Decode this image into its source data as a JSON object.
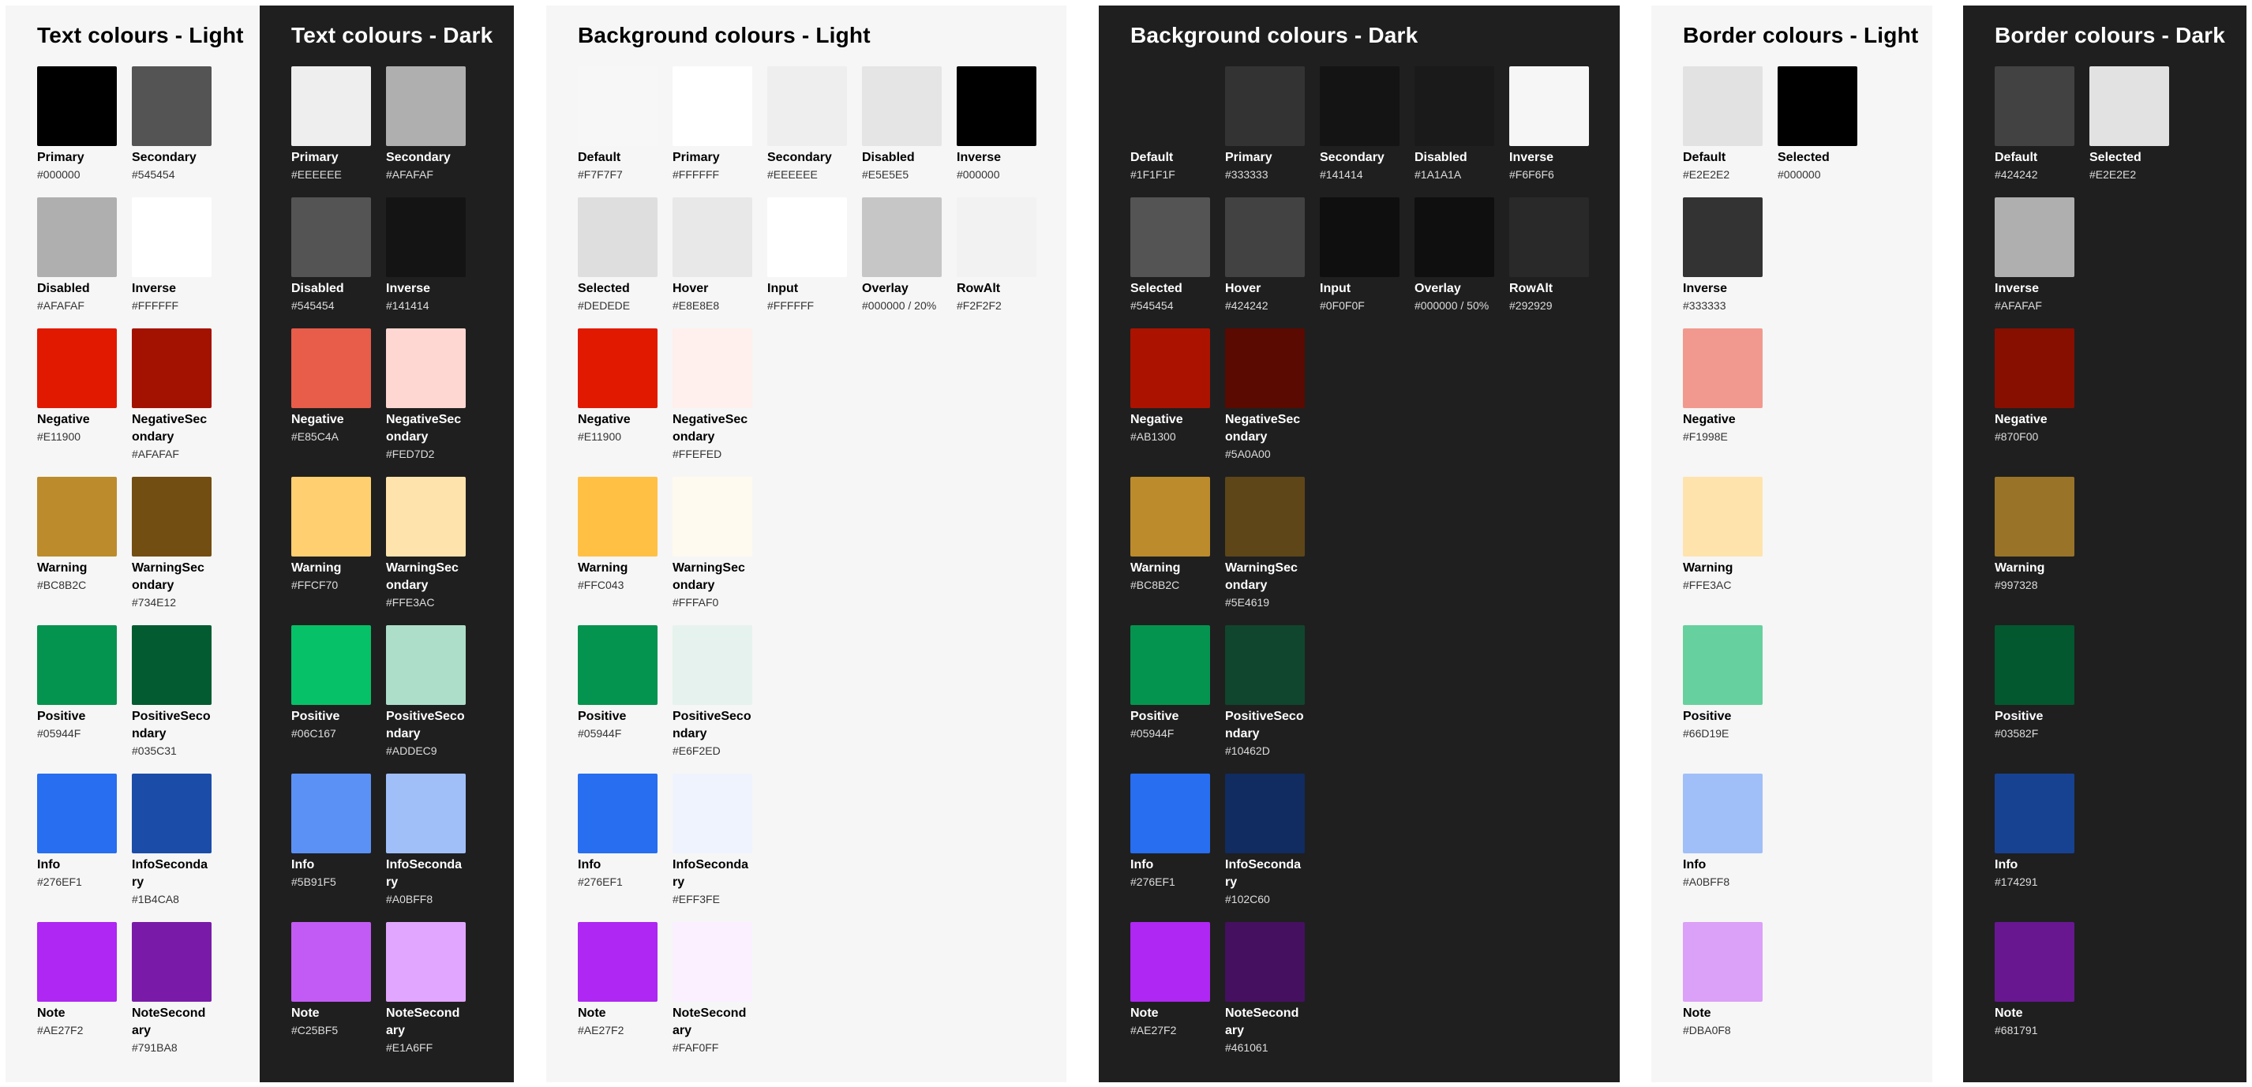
{
  "panels": [
    {
      "id": "text-light",
      "title": "Text colours - Light",
      "theme": "light",
      "columns": 2,
      "rows": [
        [
          {
            "name": "Primary",
            "hex": "#000000",
            "color": "#000000"
          },
          {
            "name": "Secondary",
            "hex": "#545454",
            "color": "#545454"
          }
        ],
        [
          {
            "name": "Disabled",
            "hex": "#AFAFAF",
            "color": "#AFAFAF"
          },
          {
            "name": "Inverse",
            "hex": "#FFFFFF",
            "color": "#FFFFFF"
          }
        ],
        [
          {
            "name": "Negative",
            "hex": "#E11900",
            "color": "#E11900"
          },
          {
            "name": "NegativeSecondary",
            "hex": "#AFAFAF",
            "color": "#A31201"
          }
        ],
        [
          {
            "name": "Warning",
            "hex": "#BC8B2C",
            "color": "#BC8B2C"
          },
          {
            "name": "WarningSecondary",
            "hex": "#734E12",
            "color": "#734E12"
          }
        ],
        [
          {
            "name": "Positive",
            "hex": "#05944F",
            "color": "#05944F"
          },
          {
            "name": "PositiveSecondary",
            "hex": "#035C31",
            "color": "#035C31"
          }
        ],
        [
          {
            "name": "Info",
            "hex": "#276EF1",
            "color": "#276EF1"
          },
          {
            "name": "InfoSecondary",
            "hex": "#1B4CA8",
            "color": "#1B4CA8"
          }
        ],
        [
          {
            "name": "Note",
            "hex": "#AE27F2",
            "color": "#AE27F2"
          },
          {
            "name": "NoteSecondary",
            "hex": "#791BA8",
            "color": "#791BA8"
          }
        ]
      ]
    },
    {
      "id": "text-dark",
      "title": "Text colours - Dark",
      "theme": "dark",
      "columns": 2,
      "rows": [
        [
          {
            "name": "Primary",
            "hex": "#EEEEEE",
            "color": "#EEEEEE"
          },
          {
            "name": "Secondary",
            "hex": "#AFAFAF",
            "color": "#AFAFAF"
          }
        ],
        [
          {
            "name": "Disabled",
            "hex": "#545454",
            "color": "#545454"
          },
          {
            "name": "Inverse",
            "hex": "#141414",
            "color": "#141414"
          }
        ],
        [
          {
            "name": "Negative",
            "hex": "#E85C4A",
            "color": "#E85C4A"
          },
          {
            "name": "NegativeSecondary",
            "hex": "#FED7D2",
            "color": "#FED7D2"
          }
        ],
        [
          {
            "name": "Warning",
            "hex": "#FFCF70",
            "color": "#FFCF70"
          },
          {
            "name": "WarningSecondary",
            "hex": "#FFE3AC",
            "color": "#FFE3AC"
          }
        ],
        [
          {
            "name": "Positive",
            "hex": "#06C167",
            "color": "#06C167"
          },
          {
            "name": "PositiveSecondary",
            "hex": "#ADDEC9",
            "color": "#ADDEC9"
          }
        ],
        [
          {
            "name": "Info",
            "hex": "#5B91F5",
            "color": "#5B91F5"
          },
          {
            "name": "InfoSecondary",
            "hex": "#A0BFF8",
            "color": "#A0BFF8"
          }
        ],
        [
          {
            "name": "Note",
            "hex": "#C25BF5",
            "color": "#C25BF5"
          },
          {
            "name": "NoteSecondary",
            "hex": "#E1A6FF",
            "color": "#E1A6FF"
          }
        ]
      ]
    },
    {
      "id": "bg-light",
      "title": "Background colours - Light",
      "theme": "light",
      "columns": 5,
      "rows": [
        [
          {
            "name": "Default",
            "hex": "#F7F7F7",
            "color": "#F7F7F7"
          },
          {
            "name": "Primary",
            "hex": "#FFFFFF",
            "color": "#FFFFFF"
          },
          {
            "name": "Secondary",
            "hex": "#EEEEEE",
            "color": "#EEEEEE"
          },
          {
            "name": "Disabled",
            "hex": "#E5E5E5",
            "color": "#E5E5E5"
          },
          {
            "name": "Inverse",
            "hex": "#000000",
            "color": "#000000"
          }
        ],
        [
          {
            "name": "Selected",
            "hex": "#DEDEDE",
            "color": "#DEDEDE"
          },
          {
            "name": "Hover",
            "hex": "#E8E8E8",
            "color": "#E8E8E8"
          },
          {
            "name": "Input",
            "hex": "#FFFFFF",
            "color": "#FFFFFF"
          },
          {
            "name": "Overlay",
            "hex": "#000000 / 20%",
            "color": "#C6C6C6"
          },
          {
            "name": "RowAlt",
            "hex": "#F2F2F2",
            "color": "#F2F2F2"
          }
        ],
        [
          {
            "name": "Negative",
            "hex": "#E11900",
            "color": "#E11900"
          },
          {
            "name": "NegativeSecondary",
            "hex": "#FFEFED",
            "color": "#FFEFED"
          }
        ],
        [
          {
            "name": "Warning",
            "hex": "#FFC043",
            "color": "#FFC043"
          },
          {
            "name": "WarningSecondary",
            "hex": "#FFFAF0",
            "color": "#FFFAF0"
          }
        ],
        [
          {
            "name": "Positive",
            "hex": "#05944F",
            "color": "#05944F"
          },
          {
            "name": "PositiveSecondary",
            "hex": "#E6F2ED",
            "color": "#E6F2ED"
          }
        ],
        [
          {
            "name": "Info",
            "hex": "#276EF1",
            "color": "#276EF1"
          },
          {
            "name": "InfoSecondary",
            "hex": "#EFF3FE",
            "color": "#EFF3FE"
          }
        ],
        [
          {
            "name": "Note",
            "hex": "#AE27F2",
            "color": "#AE27F2"
          },
          {
            "name": "NoteSecondary",
            "hex": "#FAF0FF",
            "color": "#FAF0FF"
          }
        ]
      ]
    },
    {
      "id": "bg-dark",
      "title": "Background colours - Dark",
      "theme": "dark",
      "columns": 5,
      "rows": [
        [
          {
            "name": "Default",
            "hex": "#1F1F1F",
            "color": "#1F1F1F"
          },
          {
            "name": "Primary",
            "hex": "#333333",
            "color": "#333333"
          },
          {
            "name": "Secondary",
            "hex": "#141414",
            "color": "#141414"
          },
          {
            "name": "Disabled",
            "hex": "#1A1A1A",
            "color": "#1A1A1A"
          },
          {
            "name": "Inverse",
            "hex": "#F6F6F6",
            "color": "#F6F6F6"
          }
        ],
        [
          {
            "name": "Selected",
            "hex": "#545454",
            "color": "#545454"
          },
          {
            "name": "Hover",
            "hex": "#424242",
            "color": "#424242"
          },
          {
            "name": "Input",
            "hex": "#0F0F0F",
            "color": "#0F0F0F"
          },
          {
            "name": "Overlay",
            "hex": "#000000 / 50%",
            "color": "#0F0F0F"
          },
          {
            "name": "RowAlt",
            "hex": "#292929",
            "color": "#292929"
          }
        ],
        [
          {
            "name": "Negative",
            "hex": "#AB1300",
            "color": "#AB1300"
          },
          {
            "name": "NegativeSecondary",
            "hex": "#5A0A00",
            "color": "#5A0A00"
          }
        ],
        [
          {
            "name": "Warning",
            "hex": "#BC8B2C",
            "color": "#BC8B2C"
          },
          {
            "name": "WarningSecondary",
            "hex": "#5E4619",
            "color": "#5E4619"
          }
        ],
        [
          {
            "name": "Positive",
            "hex": "#05944F",
            "color": "#05944F"
          },
          {
            "name": "PositiveSecondary",
            "hex": "#10462D",
            "color": "#10462D"
          }
        ],
        [
          {
            "name": "Info",
            "hex": "#276EF1",
            "color": "#276EF1"
          },
          {
            "name": "InfoSecondary",
            "hex": "#102C60",
            "color": "#102C60"
          }
        ],
        [
          {
            "name": "Note",
            "hex": "#AE27F2",
            "color": "#AE27F2"
          },
          {
            "name": "NoteSecondary",
            "hex": "#461061",
            "color": "#461061"
          }
        ]
      ]
    },
    {
      "id": "border-light",
      "title": "Border colours - Light",
      "theme": "light",
      "columns": 2,
      "rows": [
        [
          {
            "name": "Default",
            "hex": "#E2E2E2",
            "color": "#E2E2E2"
          },
          {
            "name": "Selected",
            "hex": "#000000",
            "color": "#000000"
          }
        ],
        [
          {
            "name": "Inverse",
            "hex": "#333333",
            "color": "#333333"
          }
        ],
        [
          {
            "name": "Negative",
            "hex": "#F1998E",
            "color": "#F1998E"
          }
        ],
        [
          {
            "name": "Warning",
            "hex": "#FFE3AC",
            "color": "#FFE3AC"
          }
        ],
        [
          {
            "name": "Positive",
            "hex": "#66D19E",
            "color": "#66D19E"
          }
        ],
        [
          {
            "name": "Info",
            "hex": "#A0BFF8",
            "color": "#A0BFF8"
          }
        ],
        [
          {
            "name": "Note",
            "hex": "#DBA0F8",
            "color": "#DBA0F8"
          }
        ]
      ]
    },
    {
      "id": "border-dark",
      "title": "Border colours - Dark",
      "theme": "dark",
      "columns": 2,
      "rows": [
        [
          {
            "name": "Default",
            "hex": "#424242",
            "color": "#424242"
          },
          {
            "name": "Selected",
            "hex": "#E2E2E2",
            "color": "#E2E2E2"
          }
        ],
        [
          {
            "name": "Inverse",
            "hex": "#AFAFAF",
            "color": "#AFAFAF"
          }
        ],
        [
          {
            "name": "Negative",
            "hex": "#870F00",
            "color": "#870F00"
          }
        ],
        [
          {
            "name": "Warning",
            "hex": "#997328",
            "color": "#997328"
          }
        ],
        [
          {
            "name": "Positive",
            "hex": "#03582F",
            "color": "#03582F"
          }
        ],
        [
          {
            "name": "Info",
            "hex": "#174291",
            "color": "#174291"
          }
        ],
        [
          {
            "name": "Note",
            "hex": "#681791",
            "color": "#681791"
          }
        ]
      ]
    }
  ]
}
